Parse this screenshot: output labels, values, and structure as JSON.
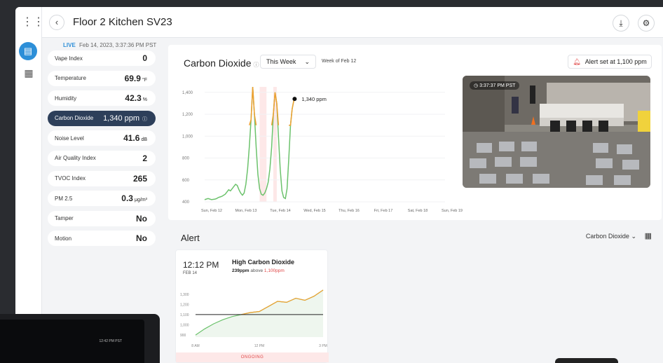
{
  "window": {
    "title": "Floor 2 Kitchen SV23"
  },
  "rail": {
    "grid_icon": "grid-icon",
    "device_icon": "device-icon",
    "apps_icon": "apps-icon"
  },
  "toolbar": {
    "back_icon": "chevron-left-icon",
    "download_icon": "download-icon",
    "settings_icon": "gear-icon"
  },
  "status": {
    "live_label": "LIVE",
    "timestamp": "Feb 14, 2023, 3:37:36 PM PST"
  },
  "sensors": [
    {
      "label": "Vape Index",
      "value": "0",
      "unit": ""
    },
    {
      "label": "Temperature",
      "value": "69.9",
      "unit": "°F"
    },
    {
      "label": "Humidity",
      "value": "42.3",
      "unit": "%"
    },
    {
      "label": "Carbon Dioxide",
      "value": "1,340 ppm",
      "unit": ""
    },
    {
      "label": "Noise Level",
      "value": "41.6",
      "unit": "dB"
    },
    {
      "label": "Air Quality Index",
      "value": "2",
      "unit": ""
    },
    {
      "label": "TVOC Index",
      "value": "265",
      "unit": ""
    },
    {
      "label": "PM 2.5",
      "value": "0.3",
      "unit": "μg/m³"
    },
    {
      "label": "Tamper",
      "value": "No",
      "unit": ""
    },
    {
      "label": "Motion",
      "value": "No",
      "unit": ""
    }
  ],
  "chart_panel": {
    "title": "Carbon Dioxide",
    "range_select": "This Week",
    "week_of": "Week of Feb 12",
    "alert_set": "Alert set at 1,100 ppm",
    "current_label": "1,340 ppm"
  },
  "camera": {
    "timestamp": "3:37:37 PM PST"
  },
  "alert_section": {
    "heading": "Alert",
    "filter": "Carbon Dioxide",
    "card": {
      "time": "12:12 PM",
      "date": "FEB 14",
      "title": "High Carbon Dioxide",
      "ppm": "239ppm",
      "above": " above ",
      "limit": "1,100ppm",
      "status": "ONGOING"
    }
  },
  "tablet": {
    "timestamp": "12:42 PM PST"
  },
  "colors": {
    "accent": "#2d8fd8",
    "active_row": "#2d3f5a",
    "line_green": "#6cc26c",
    "line_orange": "#f0a030",
    "alert_red": "#e04848"
  },
  "chart_data": [
    {
      "type": "line",
      "title": "Carbon Dioxide",
      "x_ticks": [
        "Sun, Feb 12",
        "Mon, Feb 13",
        "Tue, Feb 14",
        "Wed, Feb 15",
        "Thu, Feb 16",
        "Fri, Feb 17",
        "Sat, Feb 18",
        "Sun, Feb 19"
      ],
      "y_ticks": [
        "400",
        "600",
        "800",
        "1,000",
        "1,200",
        "1,400"
      ],
      "ylim": [
        400,
        1450
      ],
      "threshold": 1100,
      "x": [
        0,
        0.1,
        0.2,
        0.3,
        0.35,
        0.4,
        0.45,
        0.5,
        0.55,
        0.6,
        0.65,
        0.7,
        0.75,
        0.8,
        0.85,
        0.9,
        0.95,
        1.0,
        1.05,
        1.1,
        1.15,
        1.2,
        1.25,
        1.3,
        1.35,
        1.4,
        1.45,
        1.5,
        1.55,
        1.6,
        1.65,
        1.7,
        1.75,
        1.8,
        1.85,
        1.9,
        1.95,
        2.0,
        2.05,
        2.1,
        2.15,
        2.2,
        2.25,
        2.3,
        2.35,
        2.4,
        2.45,
        2.5,
        2.55,
        2.6,
        2.62
      ],
      "y": [
        420,
        430,
        420,
        425,
        430,
        440,
        445,
        450,
        460,
        470,
        490,
        510,
        500,
        520,
        540,
        560,
        550,
        510,
        480,
        460,
        480,
        560,
        700,
        900,
        1150,
        1450,
        1200,
        900,
        650,
        520,
        470,
        460,
        480,
        520,
        580,
        700,
        900,
        1200,
        1400,
        1300,
        1000,
        700,
        500,
        440,
        430,
        520,
        800,
        1100,
        1250,
        1330,
        1340
      ],
      "series": [
        {
          "name": "",
          "values": []
        }
      ]
    },
    {
      "type": "line",
      "title": "",
      "x_ticks": [
        "8 AM",
        "12 PM",
        "3 PM"
      ],
      "y_ticks": [
        "900",
        "1,000",
        "1,100",
        "1,200",
        "1,300"
      ],
      "ylim": [
        880,
        1360
      ],
      "threshold": 1100,
      "x": [
        0,
        0.5,
        1,
        1.5,
        2,
        2.5,
        3,
        3.5,
        4,
        4.5,
        5,
        5.5,
        6,
        6.5,
        7
      ],
      "y": [
        900,
        960,
        1010,
        1050,
        1080,
        1100,
        1120,
        1130,
        1180,
        1230,
        1220,
        1260,
        1240,
        1280,
        1340
      ]
    }
  ]
}
